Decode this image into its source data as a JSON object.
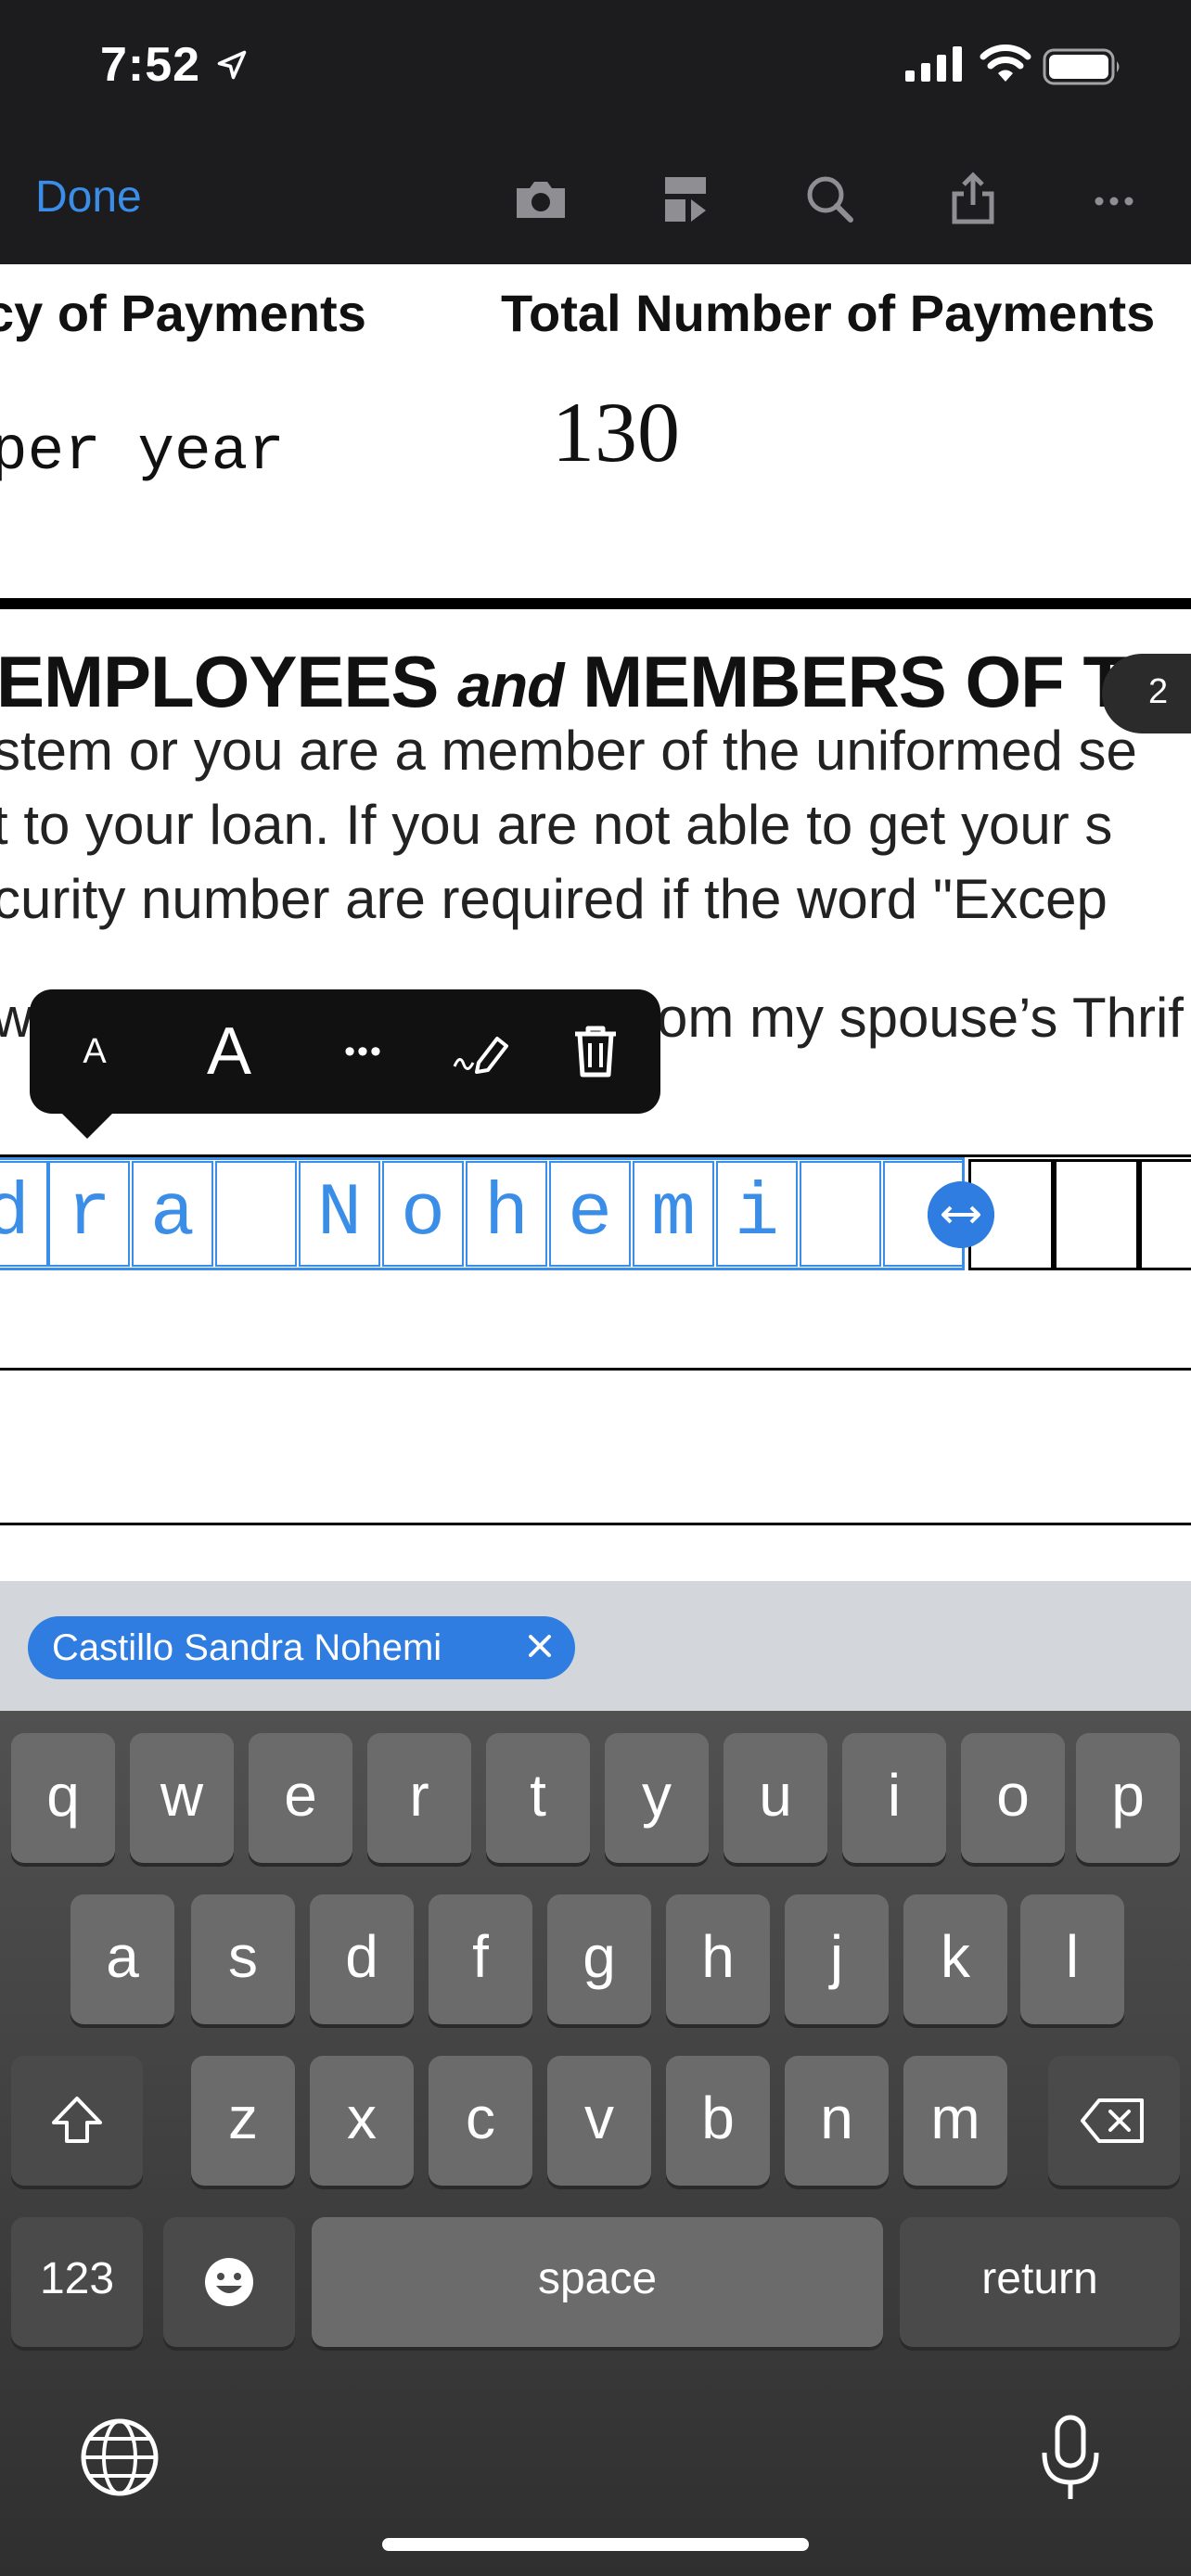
{
  "status_bar": {
    "time": "7:52",
    "icons": [
      "location-arrow-icon",
      "cellular-signal-icon",
      "wifi-icon",
      "battery-icon"
    ]
  },
  "toolbar": {
    "done_label": "Done",
    "icons": [
      "camera-icon",
      "page-layout-icon",
      "search-icon",
      "share-icon",
      "more-icon"
    ],
    "accent_color": "#3b8ee8"
  },
  "document": {
    "col1_heading": "cy of Payments",
    "col2_heading": "Total Number of Payments",
    "col1_value": "per year",
    "col2_value": "130",
    "section_heading_part1": "EMPLOYEES ",
    "section_heading_and": "and",
    "section_heading_part2": " MEMBERS OF THE UN",
    "body_lines": [
      "stem or you are a member of the uniformed se",
      "t to your loan. If you are not able to get your s",
      "curity number are required if the word \"Excep"
    ],
    "partial_left": "w,",
    "partial_right": "om my spouse’s Thrif",
    "page_number": "2"
  },
  "annotation_toolbar": {
    "small_font_label": "A",
    "large_font_label": "A",
    "more_label": "•••",
    "icons": [
      "signature-pen-icon",
      "trash-icon"
    ]
  },
  "comb_field": {
    "chars": [
      "d",
      "r",
      "a",
      "",
      "N",
      "o",
      "h",
      "e",
      "m",
      "i",
      "",
      ""
    ]
  },
  "autofill": {
    "suggestion": "Castillo Sandra Nohemi"
  },
  "keyboard": {
    "row1": [
      "q",
      "w",
      "e",
      "r",
      "t",
      "y",
      "u",
      "i",
      "o",
      "p"
    ],
    "row2": [
      "a",
      "s",
      "d",
      "f",
      "g",
      "h",
      "j",
      "k",
      "l"
    ],
    "row3": [
      "z",
      "x",
      "c",
      "v",
      "b",
      "n",
      "m"
    ],
    "numbers_label": "123",
    "space_label": "space",
    "return_label": "return",
    "icons": [
      "shift-icon",
      "backspace-icon",
      "emoji-icon",
      "globe-icon",
      "microphone-icon"
    ]
  }
}
